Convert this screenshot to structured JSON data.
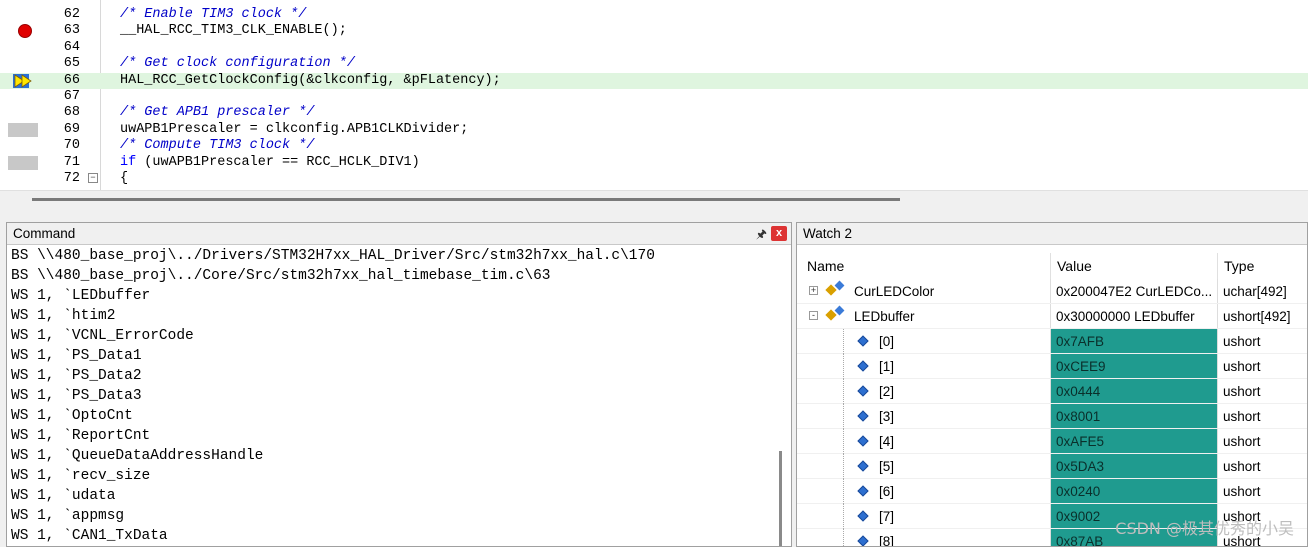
{
  "editor": {
    "lines": [
      {
        "num": "62",
        "type": "comment",
        "text": "/* Enable TIM3 clock */",
        "mark": "none",
        "current": false
      },
      {
        "num": "63",
        "type": "code",
        "text": "__HAL_RCC_TIM3_CLK_ENABLE();",
        "mark": "breakpoint",
        "current": false
      },
      {
        "num": "64",
        "type": "code",
        "text": "",
        "mark": "none",
        "current": false
      },
      {
        "num": "65",
        "type": "comment",
        "text": "/* Get clock configuration */",
        "mark": "none",
        "current": false
      },
      {
        "num": "66",
        "type": "code",
        "text": "HAL_RCC_GetClockConfig(&clkconfig, &pFLatency);",
        "mark": "current-arrow",
        "current": true
      },
      {
        "num": "67",
        "type": "code",
        "text": "",
        "mark": "none",
        "current": false
      },
      {
        "num": "68",
        "type": "comment",
        "text": "/* Get APB1 prescaler */",
        "mark": "none",
        "current": false
      },
      {
        "num": "69",
        "type": "code",
        "text": "uwAPB1Prescaler = clkconfig.APB1CLKDivider;",
        "mark": "grey",
        "current": false
      },
      {
        "num": "70",
        "type": "comment",
        "text": "/* Compute TIM3 clock */",
        "mark": "none",
        "current": false
      },
      {
        "num": "71",
        "type": "if",
        "text": " (uwAPB1Prescaler == RCC_HCLK_DIV1)",
        "keyword": "if",
        "mark": "grey",
        "current": false
      },
      {
        "num": "72",
        "type": "code",
        "text": "{",
        "mark": "fold",
        "current": false
      }
    ]
  },
  "command": {
    "title": "Command",
    "pin_glyph": "ᵖ",
    "close_glyph": "x",
    "lines": [
      "BS \\\\480_base_proj\\../Drivers/STM32H7xx_HAL_Driver/Src/stm32h7xx_hal.c\\170",
      "BS \\\\480_base_proj\\../Core/Src/stm32h7xx_hal_timebase_tim.c\\63",
      "WS 1, `LEDbuffer",
      "WS 1, `htim2",
      "WS 1, `VCNL_ErrorCode",
      "WS 1, `PS_Data1",
      "WS 1, `PS_Data2",
      "WS 1, `PS_Data3",
      "WS 1, `OptoCnt",
      "WS 1, `ReportCnt",
      "WS 1, `QueueDataAddressHandle",
      "WS 1, `recv_size",
      "WS 1, `udata",
      "WS 1, `appmsg",
      "WS 1, `CAN1_TxData"
    ]
  },
  "watch": {
    "title": "Watch 2",
    "columns": {
      "name": "Name",
      "value": "Value",
      "type": "Type"
    },
    "highlight_color": "#1f9b8f",
    "rows": [
      {
        "name": "CurLEDColor",
        "value": "0x200047E2 CurLEDCo...",
        "type": "uchar[492]",
        "kind": "struct",
        "expander": "+",
        "highlight": false
      },
      {
        "name": "LEDbuffer",
        "value": "0x30000000 LEDbuffer",
        "type": "ushort[492]",
        "kind": "struct",
        "expander": "-",
        "highlight": false
      },
      {
        "name": "[0]",
        "value": "0x7AFB",
        "type": "ushort",
        "kind": "element",
        "highlight": true
      },
      {
        "name": "[1]",
        "value": "0xCEE9",
        "type": "ushort",
        "kind": "element",
        "highlight": true
      },
      {
        "name": "[2]",
        "value": "0x0444",
        "type": "ushort",
        "kind": "element",
        "highlight": true
      },
      {
        "name": "[3]",
        "value": "0x8001",
        "type": "ushort",
        "kind": "element",
        "highlight": true
      },
      {
        "name": "[4]",
        "value": "0xAFE5",
        "type": "ushort",
        "kind": "element",
        "highlight": true
      },
      {
        "name": "[5]",
        "value": "0x5DA3",
        "type": "ushort",
        "kind": "element",
        "highlight": true
      },
      {
        "name": "[6]",
        "value": "0x0240",
        "type": "ushort",
        "kind": "element",
        "highlight": true
      },
      {
        "name": "[7]",
        "value": "0x9002",
        "type": "ushort",
        "kind": "element",
        "highlight": true
      },
      {
        "name": "[8]",
        "value": "0x87AB",
        "type": "ushort",
        "kind": "element",
        "highlight": true
      }
    ]
  },
  "watermark": "CSDN @极其优秀的小吴"
}
